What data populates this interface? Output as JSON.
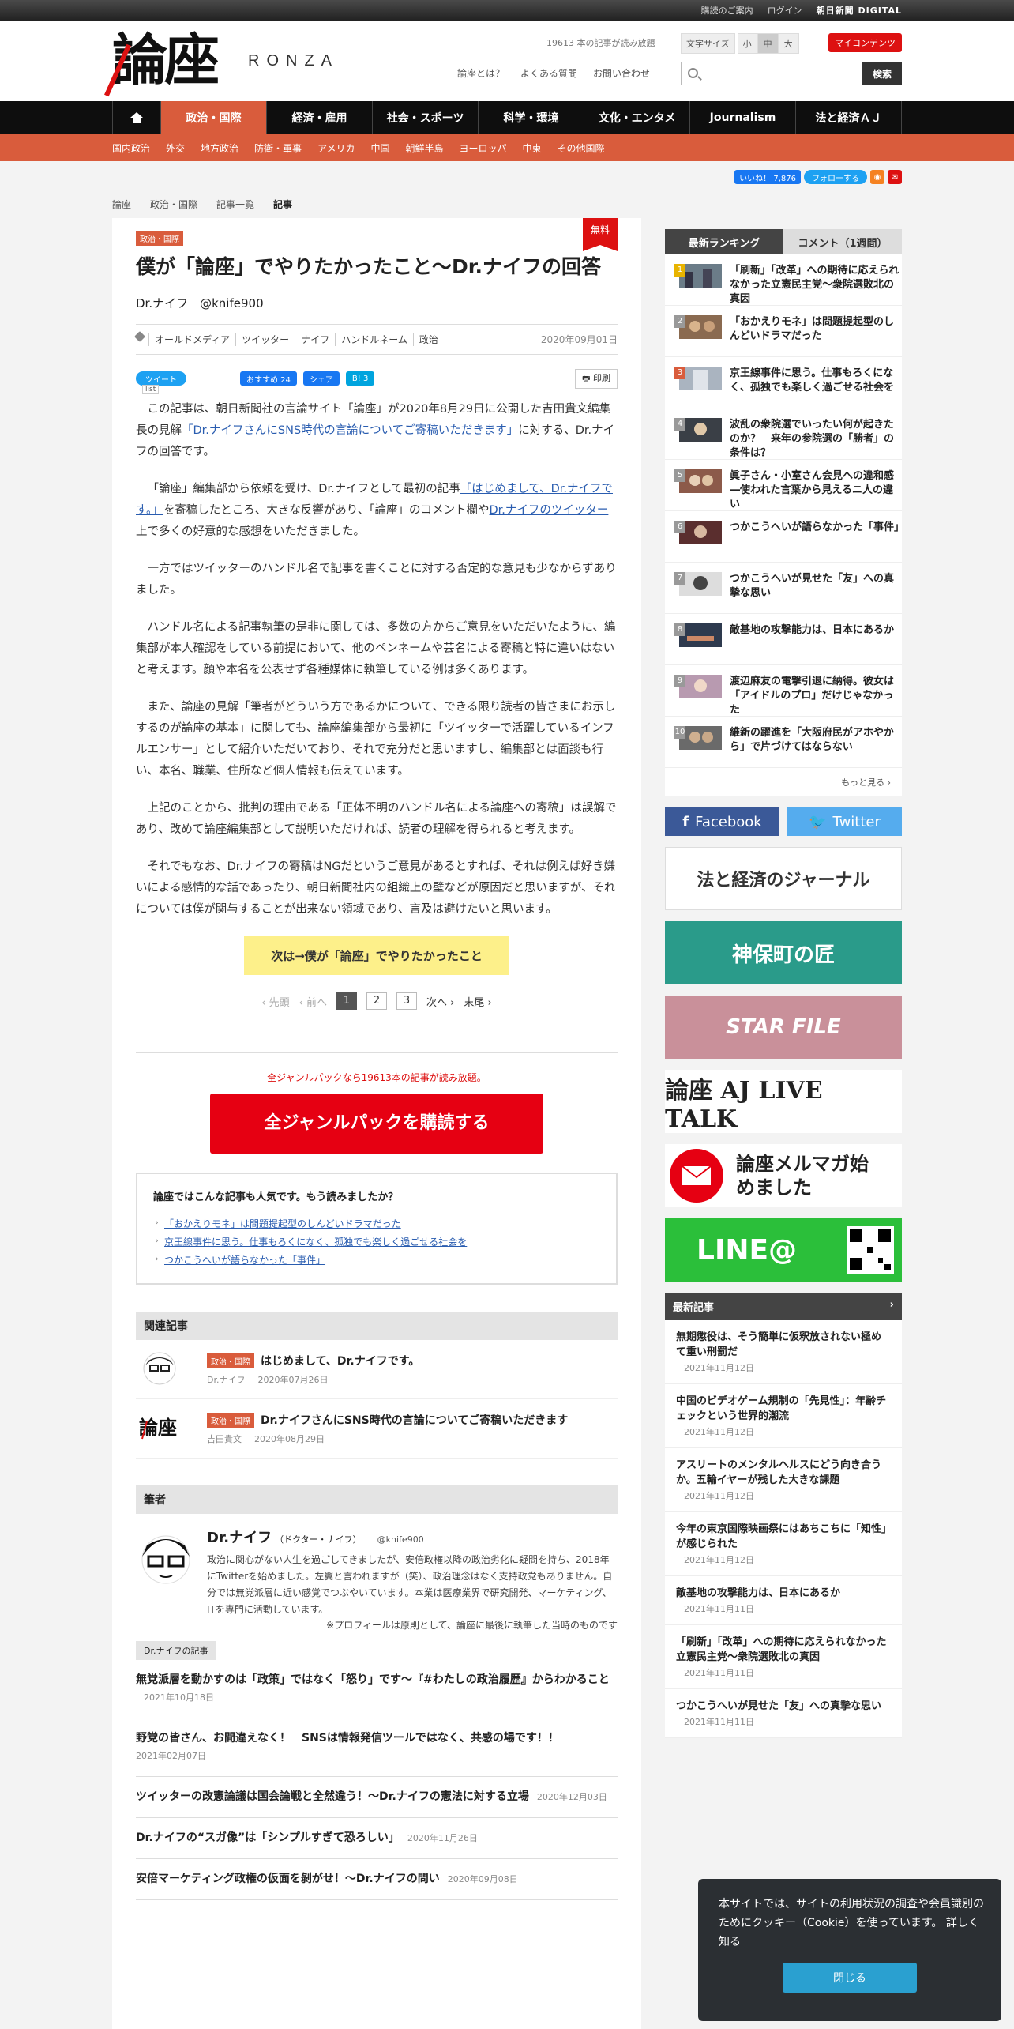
{
  "topbar": {
    "subscribe": "購読のご案内",
    "login": "ログイン",
    "brand": "朝日新聞 DIGITAL"
  },
  "header": {
    "logo_kanji": "論座",
    "logo_roman": "RONZA",
    "count_text": "19613 本の記事が読み放題",
    "links": [
      "論座とは？",
      "よくある質問",
      "お問い合わせ"
    ],
    "fontsize_label": "文字サイズ",
    "fontsize_options": [
      "小",
      "中",
      "大"
    ],
    "mycontents": "マイコンテンツ",
    "search_placeholder": "",
    "search_button": "検索"
  },
  "gnav": [
    "政治・国際",
    "経済・雇用",
    "社会・スポーツ",
    "科学・環境",
    "文化・エンタメ",
    "Journalism",
    "法と経済ＡＪ"
  ],
  "subnav": [
    "国内政治",
    "外交",
    "地方政治",
    "防衛・軍事",
    "アメリカ",
    "中国",
    "朝鮮半島",
    "ヨーロッパ",
    "中東",
    "その他国際"
  ],
  "social": {
    "like": "いいね！ 7,876",
    "follow": "フォローする"
  },
  "breadcrumb": [
    "論座",
    "政治・国際",
    "記事一覧",
    "記事"
  ],
  "article": {
    "category": "政治・国際",
    "free": "無料",
    "title": "僕が「論座」でやりたかったこと～Dr.ナイフの回答",
    "author": "Dr.ナイフ　@knife900",
    "tags": [
      "オールドメディア",
      "ツイッター",
      "ナイフ",
      "ハンドルネーム",
      "政治"
    ],
    "date": "2020年09月01日",
    "share": {
      "tweet": "ツイート",
      "recommend": "おすすめ 24",
      "share": "シェア",
      "hatena": "B! 3",
      "list": "list",
      "print": "印刷"
    },
    "p1a": "この記事は、朝日新聞社の言論サイト「論座」が2020年8月29日に公開した吉田貴文編集長の見解",
    "p1link": "「Dr.ナイフさんにSNS時代の言論についてご寄稿いただきます」",
    "p1b": "に対する、Dr.ナイフの回答です。",
    "p2a": "「論座」編集部から依頼を受け、Dr.ナイフとして最初の記事",
    "p2link": "「はじめまして、Dr.ナイフです。」",
    "p2b": "を寄稿したところ、大きな反響があり、「論座」のコメント欄や",
    "p2link2": "Dr.ナイフのツイッター",
    "p2c": "上で多くの好意的な感想をいただきました。",
    "p3": "一方ではツイッターのハンドル名で記事を書くことに対する否定的な意見も少なからずありました。",
    "p4": "ハンドル名による記事執筆の是非に関しては、多数の方からご意見をいただいたように、編集部が本人確認をしている前提において、他のペンネームや芸名による寄稿と特に違いはないと考えます。顔や本名を公表せず各種媒体に執筆している例は多くあります。",
    "p5": "また、論座の見解「筆者がどういう方であるかについて、できる限り読者の皆さまにお示しするのが論座の基本」に関しても、論座編集部から最初に「ツイッターで活躍しているインフルエンサー」として紹介いただいており、それで充分だと思いますし、編集部とは面談も行い、本名、職業、住所など個人情報も伝えています。",
    "p6": "上記のことから、批判の理由である「正体不明のハンドル名による論座への寄稿」は誤解であり、改めて論座編集部として説明いただければ、読者の理解を得られると考えます。",
    "p7": "それでもなお、Dr.ナイフの寄稿はNGだというご意見があるとすれば、それは例えば好き嫌いによる感情的な話であったり、朝日新聞社内の組織上の壁などが原因だと思いますが、それについては僕が関与することが出来ない領域であり、言及は避けたいと思います。",
    "next": "次は→僕が「論座」でやりたかったこと"
  },
  "pager": {
    "first": "先頭",
    "prev": "前へ",
    "pages": [
      "1",
      "2",
      "3"
    ],
    "next": "次へ",
    "last": "末尾"
  },
  "subscribe": {
    "lead": "全ジャンルパックなら19613本の記事が読み放題。",
    "button": "全ジャンルパックを購読する"
  },
  "popular": {
    "heading": "論座ではこんな記事も人気です。もう読みましたか？",
    "items": [
      "「おかえりモネ」は問題提起型のしんどいドラマだった",
      "京王線事件に思う。仕事もろくになく、孤独でも楽しく過ごせる社会を",
      "つかこうへいが語らなかった「事件」"
    ]
  },
  "related": {
    "heading": "関連記事",
    "items": [
      {
        "cat": "政治・国際",
        "title": "はじめまして、Dr.ナイフです。",
        "author": "Dr.ナイフ",
        "date": "2020年07月26日"
      },
      {
        "cat": "政治・国際",
        "title": "Dr.ナイフさんにSNS時代の言論についてご寄稿いただきます",
        "author": "吉田貴文",
        "date": "2020年08月29日"
      }
    ]
  },
  "writer": {
    "heading": "筆者",
    "name": "Dr.ナイフ",
    "reading": "（ドクター・ナイフ）",
    "twitter": "@knife900",
    "bio": "政治に関心がない人生を過ごしてきましたが、安倍政権以降の政治劣化に疑問を持ち、2018年にTwitterを始めました。左翼と言われますが（笑）、政治理念はなく支持政党もありません。自分では無党派層に近い感覚でつぶやいています。本業は医療業界で研究開発、マーケティング、ITを専門に活動しています。",
    "note": "※プロフィールは原則として、論座に最後に執筆した当時のものです",
    "list_label": "Dr.ナイフの記事",
    "articles": [
      {
        "title": "無党派層を動かすのは「政策」ではなく「怒り」です～『#わたしの政治履歴』からわかること",
        "date": "2021年10月18日"
      },
      {
        "title": "野党の皆さん、お間違えなく！　SNSは情報発信ツールではなく、共感の場です！！",
        "date": "2021年02月07日"
      },
      {
        "title": "ツイッターの改憲論議は国会論戦と全然違う！～Dr.ナイフの憲法に対する立場",
        "date": "2020年12月03日"
      },
      {
        "title": "Dr.ナイフの“スガ像”は「シンプルすぎて恐ろしい」",
        "date": "2020年11月26日"
      },
      {
        "title": "安倍マーケティング政権の仮面を剝がせ！～Dr.ナイフの問い",
        "date": "2020年09月08日"
      }
    ]
  },
  "ranking": {
    "tab_on": "最新ランキング",
    "tab_off": "コメント（1週間）",
    "items": [
      "「刷新」「改革」への期待に応えられなかった立憲民主党～衆院選敗北の真因",
      "「おかえりモネ」は問題提起型のしんどいドラマだった",
      "京王線事件に思う。仕事もろくになく、孤独でも楽しく過ごせる社会を",
      "波乱の衆院選でいったい何が起きたのか？　来年の参院選の「勝者」の条件は？",
      "眞子さん・小室さん会見への違和感―使われた言葉から見えるニ人の違い",
      "つかこうへいが語らなかった「事件」",
      "つかこうへいが見せた「友」への真摯な思い",
      "敵基地の攻撃能力は、日本にあるか",
      "渡辺麻友の電撃引退に納得。彼女は「アイドルのプロ」だけじゃなかった",
      "維新の躍進を「大阪府民がアホやから」で片づけてはならない"
    ],
    "more": "もっと見る"
  },
  "sns_big": {
    "facebook": "Facebook",
    "twitter": "Twitter"
  },
  "banners": [
    "法と経済のジャーナル",
    "神保町の匠",
    "STAR FILE",
    "論座 AJ LIVE TALK",
    "論座メルマガ始めました",
    "LINE@"
  ],
  "latest": {
    "heading": "最新記事",
    "items": [
      {
        "title": "無期懲役は、そう簡単に仮釈放されない極めて重い刑罰だ",
        "date": "2021年11月12日"
      },
      {
        "title": "中国のビデオゲーム規制の「先見性」：年齢チェックという世界的潮流",
        "date": "2021年11月12日"
      },
      {
        "title": "アスリートのメンタルヘルスにどう向き合うか。五輪イヤーが残した大きな課題",
        "date": "2021年11月12日"
      },
      {
        "title": "今年の東京国際映画祭にはあちこちに「知性」が感じられた",
        "date": "2021年11月12日"
      },
      {
        "title": "敵基地の攻撃能力は、日本にあるか",
        "date": "2021年11月11日"
      },
      {
        "title": "「刷新」「改革」への期待に応えられなかった立憲民主党～衆院選敗北の真因",
        "date": "2021年11月11日"
      },
      {
        "title": "つかこうへいが見せた「友」への真摯な思い",
        "date": "2021年11月11日"
      }
    ]
  },
  "cookie": {
    "text": "本サイトでは、サイトの利用状況の調査や会員識別のためにクッキー（Cookie）を使っています。 詳しく知る",
    "close": "閉じる"
  }
}
